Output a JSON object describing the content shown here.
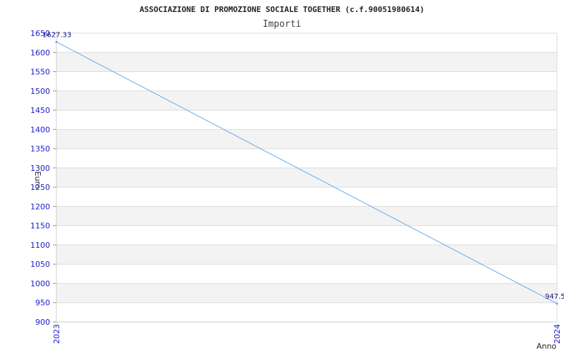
{
  "chart_data": {
    "type": "line",
    "title": "ASSOCIAZIONE DI PROMOZIONE SOCIALE TOGETHER (c.f.90051980614)",
    "subtitle": "Importi",
    "xlabel": "Anno",
    "ylabel": "Euro",
    "categories": [
      "2023",
      "2024"
    ],
    "series": [
      {
        "values": [
          1627.33,
          947.5
        ],
        "labels": [
          "1627.33",
          "947.5"
        ]
      }
    ],
    "ylim": [
      900,
      1650
    ],
    "yticks": [
      "900",
      "950",
      "1000",
      "1050",
      "1100",
      "1150",
      "1200",
      "1250",
      "1300",
      "1350",
      "1400",
      "1450",
      "1500",
      "1550",
      "1600",
      "1650"
    ],
    "ytick_values": [
      900,
      950,
      1000,
      1050,
      1100,
      1150,
      1200,
      1250,
      1300,
      1350,
      1400,
      1450,
      1500,
      1550,
      1600,
      1650
    ],
    "grid": true,
    "colors": {
      "line": "#66aaee",
      "band": "#f3f3f3",
      "grid": "#dddddd",
      "tick": "#1a1acc"
    }
  }
}
